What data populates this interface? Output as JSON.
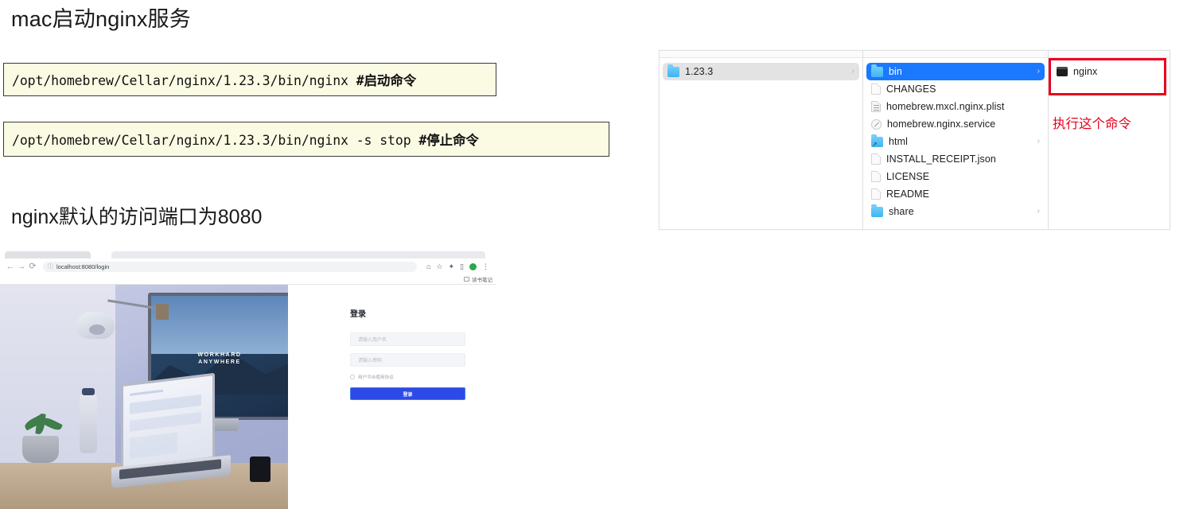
{
  "article": {
    "title": "mac启动nginx服务",
    "subtitle": "nginx默认的访问端口为8080",
    "commands": [
      {
        "cmd": "/opt/homebrew/Cellar/nginx/1.23.3/bin/nginx ",
        "note": "#启动命令"
      },
      {
        "cmd": "/opt/homebrew/Cellar/nginx/1.23.3/bin/nginx -s stop  ",
        "note": "#停止命令"
      }
    ]
  },
  "browser": {
    "back_icon": "←",
    "forward_icon": "→",
    "reload_icon": "⟳",
    "site_info_icon": "ⓘ",
    "url": "localhost:8080/login",
    "toolbar_icons": [
      {
        "name": "share-icon",
        "glyph": "⌂"
      },
      {
        "name": "bookmark-star-icon",
        "glyph": "☆"
      },
      {
        "name": "extensions-puzzle-icon",
        "glyph": "✦"
      },
      {
        "name": "side-panel-icon",
        "glyph": "▯"
      }
    ],
    "menu_icon": "⋮",
    "bookmark": {
      "label": "读书笔记"
    },
    "hero": {
      "monitor_text_line1": "WORKHARD",
      "monitor_text_line2": "ANYWHERE"
    },
    "login": {
      "title": "登录",
      "username_placeholder": "请输入用户名",
      "password_placeholder": "请输入密码",
      "agreement_label": "用户平台使用协议",
      "submit_label": "登录"
    }
  },
  "finder": {
    "column1": [
      {
        "name": "1.23.3",
        "icon": "folder",
        "state": "selected-inactive",
        "chevron": "›"
      }
    ],
    "column2": [
      {
        "name": "bin",
        "icon": "folder",
        "state": "selected",
        "chevron": "›"
      },
      {
        "name": "CHANGES",
        "icon": "doc",
        "state": "",
        "chevron": ""
      },
      {
        "name": "homebrew.mxcl.nginx.plist",
        "icon": "doc-lines",
        "state": "",
        "chevron": ""
      },
      {
        "name": "homebrew.nginx.service",
        "icon": "service",
        "state": "",
        "chevron": ""
      },
      {
        "name": "html",
        "icon": "folder-alias",
        "state": "",
        "chevron": "›"
      },
      {
        "name": "INSTALL_RECEIPT.json",
        "icon": "doc",
        "state": "",
        "chevron": ""
      },
      {
        "name": "LICENSE",
        "icon": "doc",
        "state": "",
        "chevron": ""
      },
      {
        "name": "README",
        "icon": "doc",
        "state": "",
        "chevron": ""
      },
      {
        "name": "share",
        "icon": "folder",
        "state": "",
        "chevron": "›"
      }
    ],
    "column3": [
      {
        "name": "nginx",
        "icon": "executable",
        "state": "",
        "chevron": ""
      }
    ]
  },
  "annotation": {
    "note": "执行这个命令",
    "color": "#e8001c"
  }
}
